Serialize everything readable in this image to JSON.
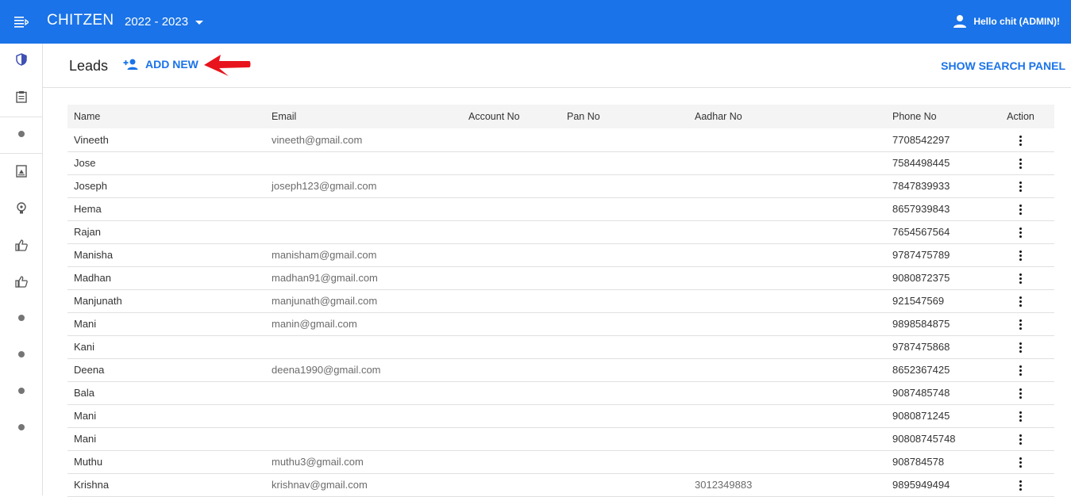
{
  "app": {
    "brand": "CHITZEN",
    "year_selector": "2022 - 2023",
    "user_greeting": "Hello chit (ADMIN)!"
  },
  "colors": {
    "primary": "#1a73e8",
    "arrow": "#e8141d"
  },
  "sidebar": {
    "items": [
      {
        "icon": "shield-icon"
      },
      {
        "icon": "clipboard-icon"
      },
      {
        "icon": "dot-icon"
      },
      {
        "icon": "portrait-icon"
      },
      {
        "icon": "lightbulb-icon"
      },
      {
        "icon": "thumbs-up-icon"
      },
      {
        "icon": "thumbs-up-icon"
      },
      {
        "icon": "dot-icon"
      },
      {
        "icon": "dot-icon"
      },
      {
        "icon": "dot-icon"
      },
      {
        "icon": "dot-icon"
      }
    ]
  },
  "page": {
    "title": "Leads",
    "add_new_label": "ADD NEW",
    "search_panel_label": "SHOW SEARCH PANEL"
  },
  "table": {
    "headers": {
      "name": "Name",
      "email": "Email",
      "account": "Account No",
      "pan": "Pan No",
      "aadhar": "Aadhar No",
      "phone": "Phone No",
      "action": "Action"
    },
    "rows": [
      {
        "name": "Vineeth",
        "email": "vineeth@gmail.com",
        "account": "",
        "pan": "",
        "aadhar": "",
        "phone": "7708542297"
      },
      {
        "name": "Jose",
        "email": "",
        "account": "",
        "pan": "",
        "aadhar": "",
        "phone": "7584498445"
      },
      {
        "name": "Joseph",
        "email": "joseph123@gmail.com",
        "account": "",
        "pan": "",
        "aadhar": "",
        "phone": "7847839933"
      },
      {
        "name": "Hema",
        "email": "",
        "account": "",
        "pan": "",
        "aadhar": "",
        "phone": "8657939843"
      },
      {
        "name": "Rajan",
        "email": "",
        "account": "",
        "pan": "",
        "aadhar": "",
        "phone": "7654567564"
      },
      {
        "name": "Manisha",
        "email": "manisham@gmail.com",
        "account": "",
        "pan": "",
        "aadhar": "",
        "phone": "9787475789"
      },
      {
        "name": "Madhan",
        "email": "madhan91@gmail.com",
        "account": "",
        "pan": "",
        "aadhar": "",
        "phone": "9080872375"
      },
      {
        "name": "Manjunath",
        "email": "manjunath@gmail.com",
        "account": "",
        "pan": "",
        "aadhar": "",
        "phone": "921547569"
      },
      {
        "name": "Mani",
        "email": "manin@gmail.com",
        "account": "",
        "pan": "",
        "aadhar": "",
        "phone": "9898584875"
      },
      {
        "name": "Kani",
        "email": "",
        "account": "",
        "pan": "",
        "aadhar": "",
        "phone": "9787475868"
      },
      {
        "name": "Deena",
        "email": "deena1990@gmail.com",
        "account": "",
        "pan": "",
        "aadhar": "",
        "phone": "8652367425"
      },
      {
        "name": "Bala",
        "email": "",
        "account": "",
        "pan": "",
        "aadhar": "",
        "phone": "9087485748"
      },
      {
        "name": "Mani",
        "email": "",
        "account": "",
        "pan": "",
        "aadhar": "",
        "phone": "9080871245"
      },
      {
        "name": "Mani",
        "email": "",
        "account": "",
        "pan": "",
        "aadhar": "",
        "phone": "90808745748"
      },
      {
        "name": "Muthu",
        "email": "muthu3@gmail.com",
        "account": "",
        "pan": "",
        "aadhar": "",
        "phone": "908784578"
      },
      {
        "name": "Krishna",
        "email": "krishnav@gmail.com",
        "account": "",
        "pan": "",
        "aadhar": "3012349883",
        "phone": "9895949494"
      }
    ]
  }
}
